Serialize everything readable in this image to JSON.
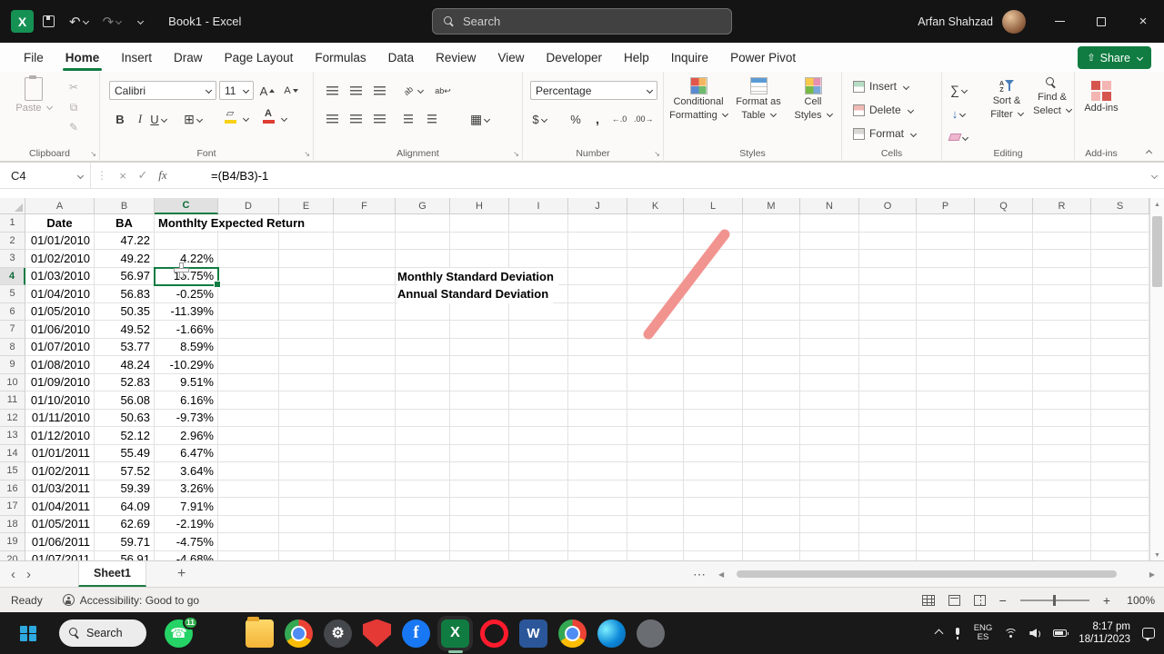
{
  "titlebar": {
    "app_title": "Book1 - Excel",
    "search_placeholder": "Search",
    "user_name": "Arfan Shahzad"
  },
  "ribbon": {
    "tabs": [
      {
        "label": "File"
      },
      {
        "label": "Home",
        "active": true
      },
      {
        "label": "Insert"
      },
      {
        "label": "Draw"
      },
      {
        "label": "Page Layout"
      },
      {
        "label": "Formulas"
      },
      {
        "label": "Data"
      },
      {
        "label": "Review"
      },
      {
        "label": "View"
      },
      {
        "label": "Developer"
      },
      {
        "label": "Help"
      },
      {
        "label": "Inquire"
      },
      {
        "label": "Power Pivot"
      }
    ],
    "share_label": "Share",
    "clipboard": {
      "caption": "Clipboard",
      "paste": "Paste"
    },
    "font": {
      "caption": "Font",
      "family": "Calibri",
      "size": "11"
    },
    "alignment": {
      "caption": "Alignment"
    },
    "number": {
      "caption": "Number",
      "format": "Percentage"
    },
    "styles": {
      "caption": "Styles",
      "cf1": "Conditional",
      "cf2": "Formatting",
      "fat1": "Format as",
      "fat2": "Table",
      "cs1": "Cell",
      "cs2": "Styles"
    },
    "cells": {
      "caption": "Cells",
      "insert": "Insert",
      "delete": "Delete",
      "format": "Format"
    },
    "editing": {
      "caption": "Editing",
      "sort1": "Sort &",
      "sort2": "Filter",
      "find1": "Find &",
      "find2": "Select"
    },
    "addins": {
      "caption": "Add-ins",
      "label": "Add-ins"
    }
  },
  "formula_bar": {
    "name_box": "C4",
    "formula": "=(B4/B3)-1"
  },
  "grid": {
    "columns": [
      "A",
      "B",
      "C",
      "D",
      "E",
      "F",
      "G",
      "H",
      "I",
      "J",
      "K",
      "L",
      "M",
      "N",
      "O",
      "P",
      "Q",
      "R",
      "S"
    ],
    "selected": {
      "cell": "C4",
      "column": "C",
      "row": 4
    },
    "rows": [
      {
        "a": "Date",
        "b": "BA",
        "c": "Monthlty Expected Return"
      },
      {
        "a": "01/01/2010",
        "b": "47.22",
        "c": ""
      },
      {
        "a": "01/02/2010",
        "b": "49.22",
        "c": "4.22%"
      },
      {
        "a": "01/03/2010",
        "b": "56.97",
        "c": "15.75%"
      },
      {
        "a": "01/04/2010",
        "b": "56.83",
        "c": "-0.25%"
      },
      {
        "a": "01/05/2010",
        "b": "50.35",
        "c": "-11.39%"
      },
      {
        "a": "01/06/2010",
        "b": "49.52",
        "c": "-1.66%"
      },
      {
        "a": "01/07/2010",
        "b": "53.77",
        "c": "8.59%"
      },
      {
        "a": "01/08/2010",
        "b": "48.24",
        "c": "-10.29%"
      },
      {
        "a": "01/09/2010",
        "b": "52.83",
        "c": "9.51%"
      },
      {
        "a": "01/10/2010",
        "b": "56.08",
        "c": "6.16%"
      },
      {
        "a": "01/11/2010",
        "b": "50.63",
        "c": "-9.73%"
      },
      {
        "a": "01/12/2010",
        "b": "52.12",
        "c": "2.96%"
      },
      {
        "a": "01/01/2011",
        "b": "55.49",
        "c": "6.47%"
      },
      {
        "a": "01/02/2011",
        "b": "57.52",
        "c": "3.64%"
      },
      {
        "a": "01/03/2011",
        "b": "59.39",
        "c": "3.26%"
      },
      {
        "a": "01/04/2011",
        "b": "64.09",
        "c": "7.91%"
      },
      {
        "a": "01/05/2011",
        "b": "62.69",
        "c": "-2.19%"
      },
      {
        "a": "01/06/2011",
        "b": "59.71",
        "c": "-4.75%"
      },
      {
        "a": "01/07/2011",
        "b": "56.91",
        "c": "-4.68%"
      }
    ],
    "side_labels": [
      {
        "row": 4,
        "text": "Monthly Standard Deviation"
      },
      {
        "row": 5,
        "text": "Annual Standard Deviation"
      }
    ]
  },
  "sheet_bar": {
    "tabs": [
      {
        "label": "Sheet1",
        "active": true
      }
    ]
  },
  "status_bar": {
    "mode": "Ready",
    "accessibility": "Accessibility: Good to go",
    "zoom": "100%"
  },
  "taskbar": {
    "search": "Search",
    "whatsapp_badge": "11",
    "language": {
      "line1": "ENG",
      "line2": "ES"
    },
    "time": "8:17 pm",
    "date": "18/11/2023"
  }
}
